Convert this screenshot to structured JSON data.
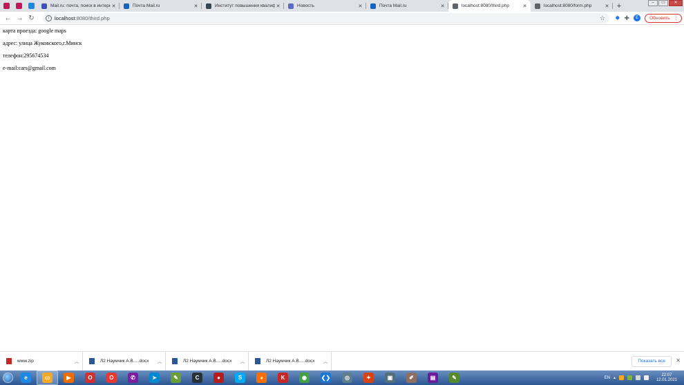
{
  "browser": {
    "pinned_tabs": [
      {
        "icon": "k-logo-icon",
        "color": "#c2185b"
      },
      {
        "icon": "k-logo-icon",
        "color": "#c2185b"
      },
      {
        "icon": "app-icon",
        "color": "#1e88e5"
      }
    ],
    "tabs": [
      {
        "title": "Mail.ru: почта, поиск в интерн",
        "icon": "mailru-at-icon",
        "color": "#3f51b5",
        "active": false
      },
      {
        "title": "Почта Mail.ru",
        "icon": "mail-envelope-icon",
        "color": "#1565c0",
        "active": false
      },
      {
        "title": "Институт повышения квалиф",
        "icon": "document-icon",
        "color": "#37474f",
        "active": false
      },
      {
        "title": "Новость",
        "icon": "mailru-at-icon",
        "color": "#5c6bc0",
        "active": false
      },
      {
        "title": "Почта Mail.ru",
        "icon": "mail-envelope-icon",
        "color": "#1565c0",
        "active": false
      },
      {
        "title": "localhost:8080/third.php",
        "icon": "globe-icon",
        "color": "#5f6368",
        "active": true
      },
      {
        "title": "localhost:8080/form.php",
        "icon": "globe-icon",
        "color": "#5f6368",
        "active": false
      }
    ],
    "url_host": "localhost",
    "url_path": ":8080/third.php",
    "profile_initial": "Е",
    "update_label": "Обновить"
  },
  "page": {
    "lines": [
      "карта проезда: google maps",
      "адрес: улица Жуковского,г.Минск",
      "телефон:295674534",
      "e-mail:cars@gmail.com"
    ]
  },
  "downloads": {
    "items": [
      {
        "name": "www.zip",
        "icon": "zip-archive-icon",
        "color": "#c62828"
      },
      {
        "name": "Л2 Наумчик А.В.....docx",
        "icon": "word-doc-icon",
        "color": "#2b579a"
      },
      {
        "name": "Л2 Наумчик А.В.....docx",
        "icon": "word-doc-icon",
        "color": "#2b579a"
      },
      {
        "name": "Л2 Наумчик А.В.....docx",
        "icon": "word-doc-icon",
        "color": "#2b579a"
      }
    ],
    "show_all_label": "Показать все"
  },
  "taskbar": {
    "apps": [
      {
        "name": "ie-icon",
        "color": "#1e88e5",
        "glyph": "e"
      },
      {
        "name": "explorer-folder-icon",
        "color": "#f9a825",
        "glyph": "▭"
      },
      {
        "name": "media-player-icon",
        "color": "#ef6c00",
        "glyph": "▶"
      },
      {
        "name": "opera-icon",
        "color": "#d32f2f",
        "glyph": "O"
      },
      {
        "name": "opera-icon",
        "color": "#e53935",
        "glyph": "O"
      },
      {
        "name": "viber-icon",
        "color": "#7b1fa2",
        "glyph": "✆"
      },
      {
        "name": "telegram-icon",
        "color": "#0288d1",
        "glyph": "➤"
      },
      {
        "name": "notepad-plus-icon",
        "color": "#689f38",
        "glyph": "✎"
      },
      {
        "name": "c-app-icon",
        "color": "#263238",
        "glyph": "C"
      },
      {
        "name": "record-icon",
        "color": "#b71c1c",
        "glyph": "●"
      },
      {
        "name": "skype-icon",
        "color": "#03a9f4",
        "glyph": "S"
      },
      {
        "name": "firefox-icon",
        "color": "#ff6f00",
        "glyph": "◕"
      },
      {
        "name": "kaspersky-icon",
        "color": "#c62828",
        "glyph": "K"
      },
      {
        "name": "chrome-icon",
        "color": "#43a047",
        "glyph": "◉"
      },
      {
        "name": "vscode-icon",
        "color": "#1976d2",
        "glyph": "❮❯"
      },
      {
        "name": "app-circle-icon",
        "color": "#607d8b",
        "glyph": "◎"
      },
      {
        "name": "star-app-icon",
        "color": "#d84315",
        "glyph": "✦"
      },
      {
        "name": "display-icon",
        "color": "#546e7a",
        "glyph": "▣"
      },
      {
        "name": "paint-icon",
        "color": "#8d6e63",
        "glyph": "✐"
      },
      {
        "name": "winrar-icon",
        "color": "#6a1b9a",
        "glyph": "▤"
      },
      {
        "name": "editor-icon",
        "color": "#558b2f",
        "glyph": "✎"
      }
    ],
    "language": "EN",
    "time": "22:07",
    "date": "12.01.2021"
  }
}
